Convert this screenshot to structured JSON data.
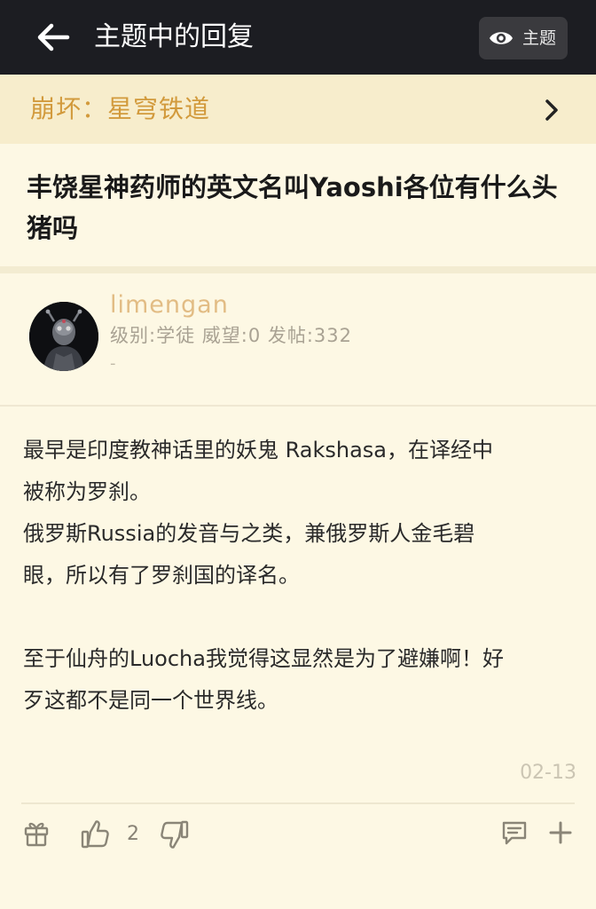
{
  "header": {
    "back_icon": "back-arrow-icon",
    "title": "主题中的回复",
    "topic_button": {
      "icon": "eye-icon",
      "label": "主题"
    }
  },
  "forum": {
    "name": "崩坏：星穹铁道",
    "icon": "chevron-right-icon"
  },
  "post": {
    "title": "丰饶星神药师的英文名叫Yaoshi各位有什么头猪吗"
  },
  "author": {
    "name": "limengan",
    "stats": "级别:学徒 威望:0 发帖:332",
    "signature": "-"
  },
  "reply": {
    "lines": [
      "最早是印度教神话里的妖鬼 Rakshasa，在译经中",
      "被称为罗刹。",
      "俄罗斯Russia的发音与之类，兼俄罗斯人金毛碧",
      "眼，所以有了罗刹国的译名。",
      "",
      "至于仙舟的Luocha我觉得这显然是为了避嫌啊！好",
      "歹这都不是同一个世界线。"
    ],
    "date": "02-13"
  },
  "actions": {
    "gift_icon": "gift-icon",
    "like_icon": "thumbs-up-icon",
    "like_count": "2",
    "dislike_icon": "thumbs-down-icon",
    "comment_icon": "comment-icon",
    "more_icon": "plus-icon"
  },
  "colors": {
    "topbar_bg": "#1c1d22",
    "forumbar_bg": "#f7edcc",
    "forum_text": "#d29a3c",
    "page_bg": "#fdf8e4",
    "username": "#e2bc84"
  }
}
